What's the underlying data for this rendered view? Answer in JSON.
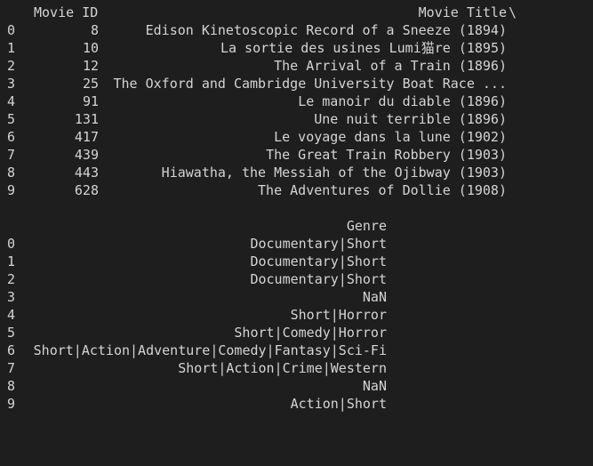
{
  "first_table": {
    "columns": {
      "movie_id": "Movie ID",
      "movie_title": "Movie Title",
      "continuation": "\\"
    },
    "rows": [
      {
        "index": "0",
        "movie_id": "8",
        "movie_title": "Edison Kinetoscopic Record of a Sneeze (1894)"
      },
      {
        "index": "1",
        "movie_id": "10",
        "movie_title": "La sortie des usines Lumi猫re (1895)"
      },
      {
        "index": "2",
        "movie_id": "12",
        "movie_title": "The Arrival of a Train (1896)"
      },
      {
        "index": "3",
        "movie_id": "25",
        "movie_title": "The Oxford and Cambridge University Boat Race ..."
      },
      {
        "index": "4",
        "movie_id": "91",
        "movie_title": "Le manoir du diable (1896)"
      },
      {
        "index": "5",
        "movie_id": "131",
        "movie_title": "Une nuit terrible (1896)"
      },
      {
        "index": "6",
        "movie_id": "417",
        "movie_title": "Le voyage dans la lune (1902)"
      },
      {
        "index": "7",
        "movie_id": "439",
        "movie_title": "The Great Train Robbery (1903)"
      },
      {
        "index": "8",
        "movie_id": "443",
        "movie_title": "Hiawatha, the Messiah of the Ojibway (1903)"
      },
      {
        "index": "9",
        "movie_id": "628",
        "movie_title": "The Adventures of Dollie (1908)"
      }
    ]
  },
  "second_table": {
    "columns": {
      "genre": "Genre"
    },
    "rows": [
      {
        "index": "0",
        "genre": "Documentary|Short"
      },
      {
        "index": "1",
        "genre": "Documentary|Short"
      },
      {
        "index": "2",
        "genre": "Documentary|Short"
      },
      {
        "index": "3",
        "genre": "NaN"
      },
      {
        "index": "4",
        "genre": "Short|Horror"
      },
      {
        "index": "5",
        "genre": "Short|Comedy|Horror"
      },
      {
        "index": "6",
        "genre": "Short|Action|Adventure|Comedy|Fantasy|Sci-Fi"
      },
      {
        "index": "7",
        "genre": "Short|Action|Crime|Western"
      },
      {
        "index": "8",
        "genre": "NaN"
      },
      {
        "index": "9",
        "genre": "Action|Short"
      }
    ]
  }
}
